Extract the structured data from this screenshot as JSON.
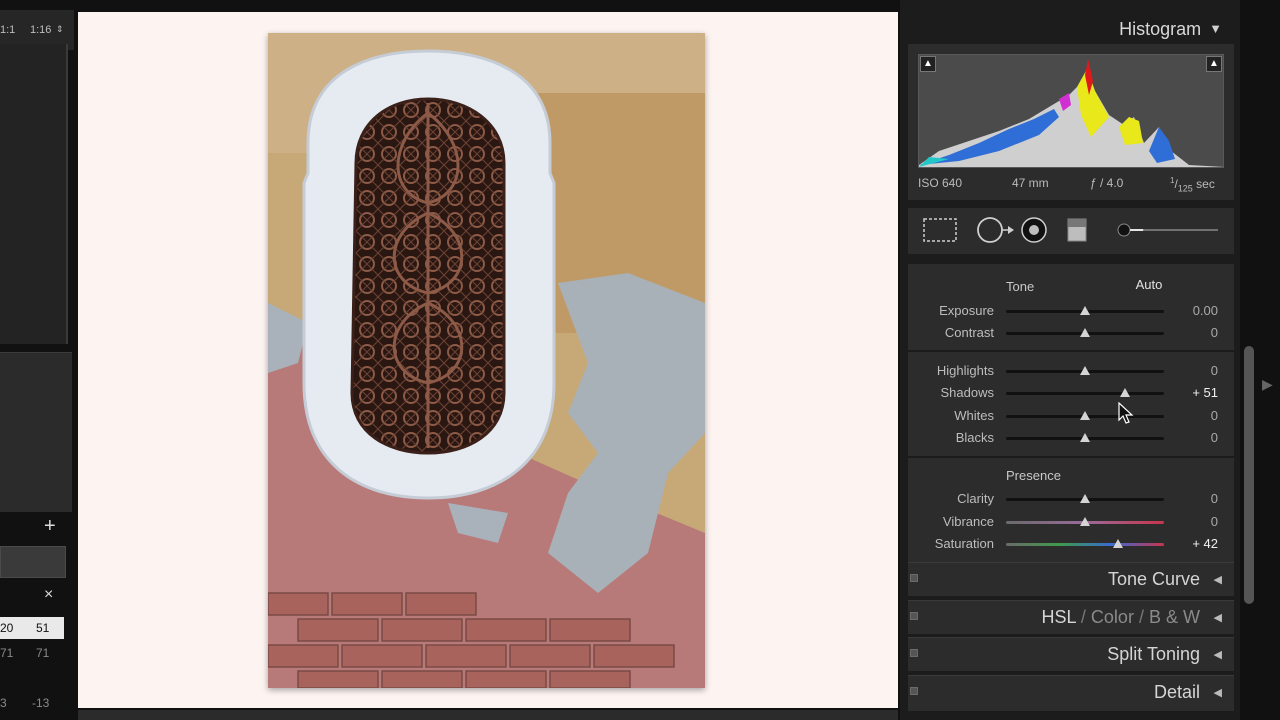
{
  "left_panel": {
    "zoom_options": [
      "1:1",
      "1:16"
    ],
    "add_label": "+",
    "close_label": "×",
    "rows": [
      {
        "a": "20",
        "b": "51",
        "selected": true
      },
      {
        "a": "71",
        "b": "71",
        "selected": false
      },
      {
        "a": "3",
        "b": "-13",
        "selected": false
      }
    ]
  },
  "histogram": {
    "title": "Histogram",
    "iso": "ISO 640",
    "focal": "47 mm",
    "aperture": "ƒ / 4.0",
    "shutter_num": "1",
    "shutter_den": "125",
    "shutter_unit": "sec",
    "shadow_clip_icon": "triangle-up-icon",
    "highlight_clip_icon": "triangle-up-icon"
  },
  "tools": {
    "icons": [
      "crop-overlay-icon",
      "spot-removal-icon",
      "red-eye-icon",
      "graduated-filter-icon",
      "adjustment-brush-icon"
    ],
    "brush_amount": 0.15
  },
  "basic": {
    "tone_label": "Tone",
    "auto_label": "Auto",
    "presence_label": "Presence",
    "sliders": [
      {
        "key": "exposure",
        "label": "Exposure",
        "value": "0.00",
        "pos": 0.5,
        "changed": false
      },
      {
        "key": "contrast",
        "label": "Contrast",
        "value": "0",
        "pos": 0.5,
        "changed": false
      },
      {
        "key": "highlights",
        "label": "Highlights",
        "value": "0",
        "pos": 0.5,
        "changed": false
      },
      {
        "key": "shadows",
        "label": "Shadows",
        "value": "+ 51",
        "pos": 0.755,
        "changed": true
      },
      {
        "key": "whites",
        "label": "Whites",
        "value": "0",
        "pos": 0.5,
        "changed": false
      },
      {
        "key": "blacks",
        "label": "Blacks",
        "value": "0",
        "pos": 0.5,
        "changed": false
      },
      {
        "key": "clarity",
        "label": "Clarity",
        "value": "0",
        "pos": 0.5,
        "changed": false
      },
      {
        "key": "vibrance",
        "label": "Vibrance",
        "value": "0",
        "pos": 0.5,
        "changed": false
      },
      {
        "key": "saturation",
        "label": "Saturation",
        "value": "+ 42",
        "pos": 0.71,
        "changed": true
      }
    ]
  },
  "panels": {
    "tone_curve": "Tone Curve",
    "hsl": "HSL",
    "hsl_sep": "/",
    "color": "Color",
    "bw": "B & W",
    "split_toning": "Split Toning",
    "detail": "Detail"
  },
  "colors": {
    "canvas_bg": "#fdf4f1",
    "panel_bg": "#2c2c2c",
    "slider_thumb": "#d4d4d4"
  }
}
